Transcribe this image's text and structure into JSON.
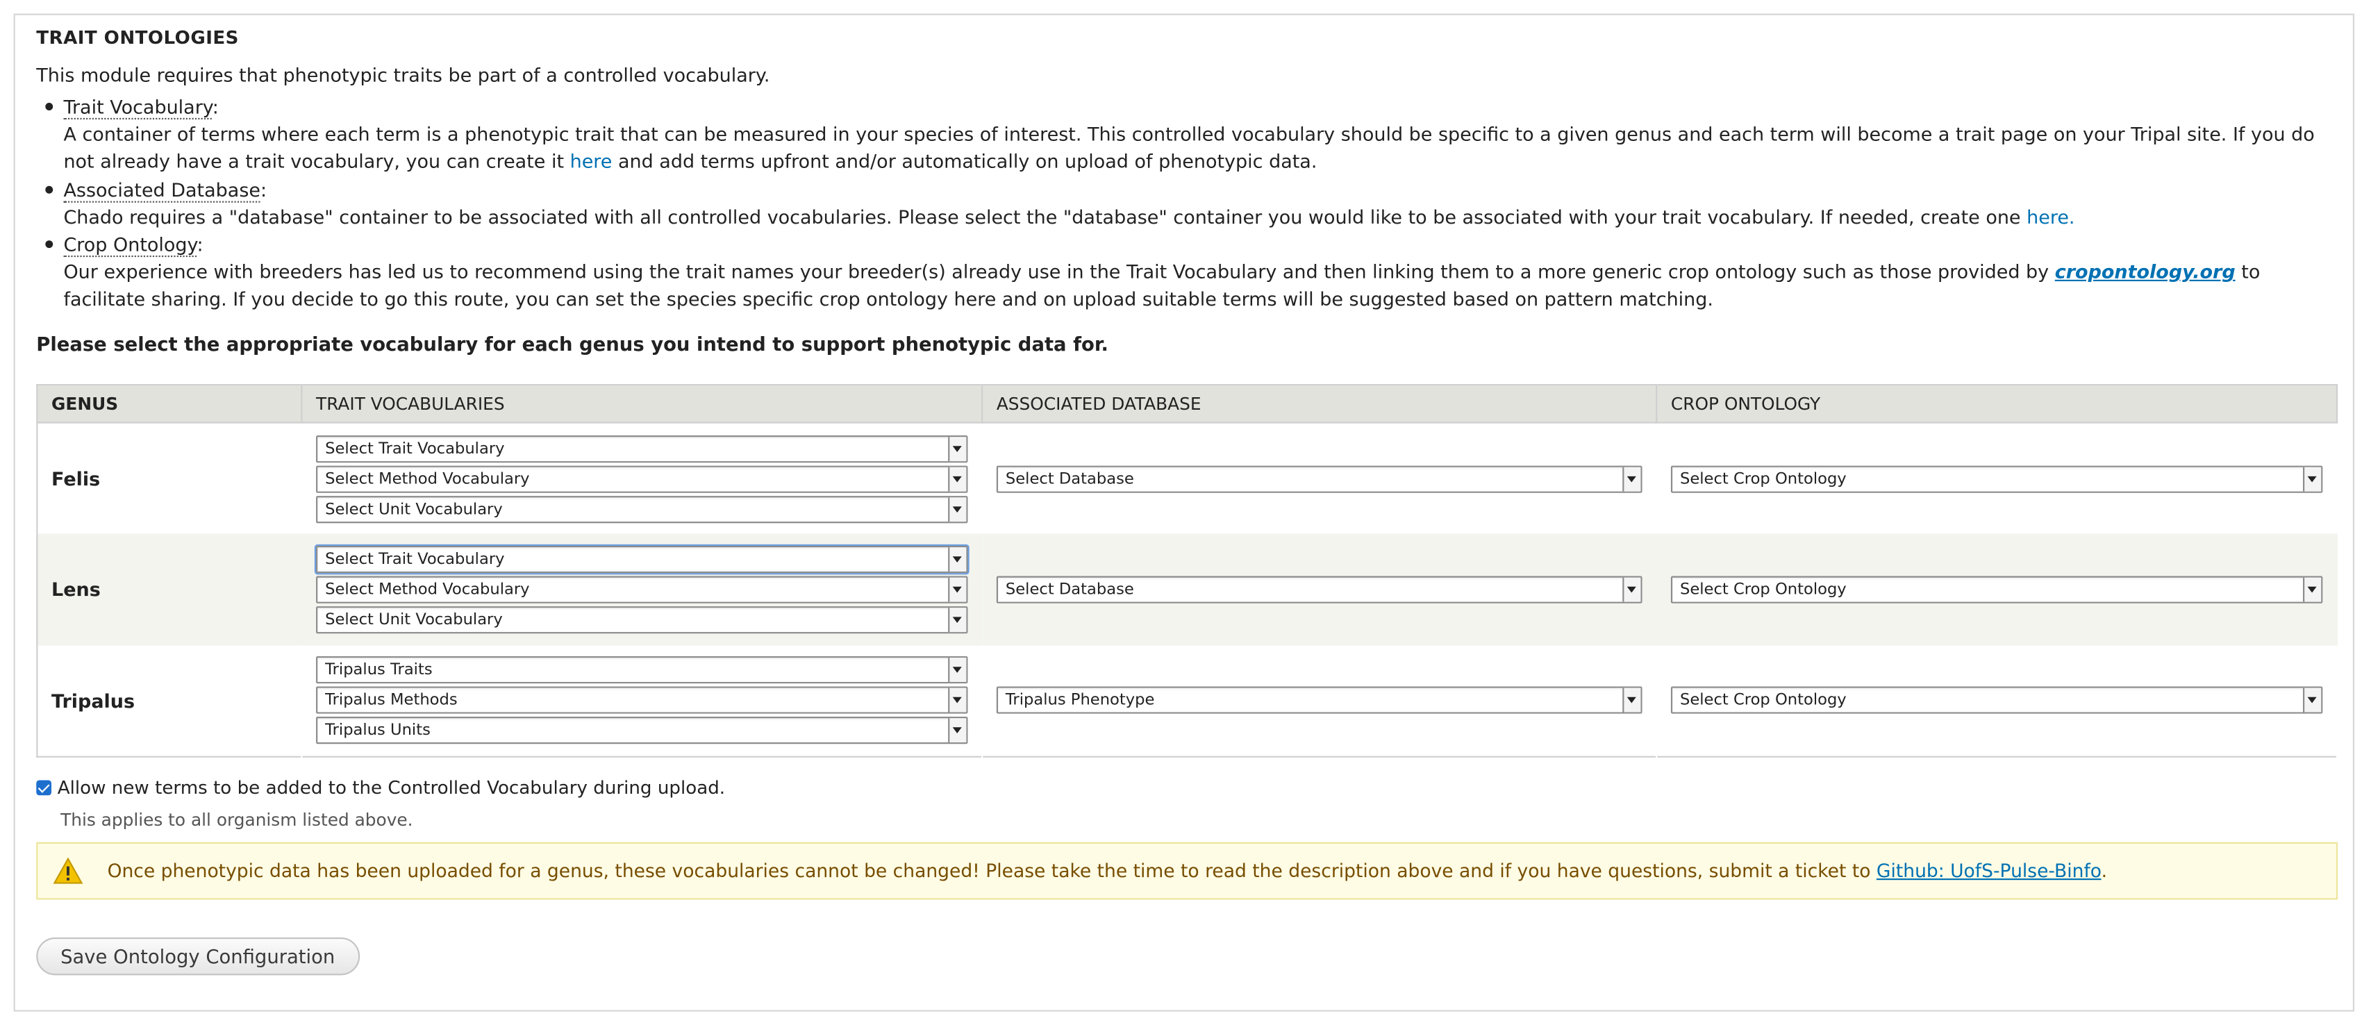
{
  "panel": {
    "title": "TRAIT ONTOLOGIES",
    "intro": "This module requires that phenotypic traits be part of a controlled vocabulary."
  },
  "definitions": [
    {
      "term": "Trait Vocabulary",
      "text_before": "A container of terms where each term is a phenotypic trait that can be measured in your species of interest. This controlled vocabulary should be specific to a given genus and each term will become a trait page on your Tripal site. If you do not already have a trait vocabulary, you can create it ",
      "link": "here",
      "text_after": " and add terms upfront and/or automatically on upload of phenotypic data."
    },
    {
      "term": "Associated Database",
      "text_before": "Chado requires a \"database\" container to be associated with all controlled vocabularies. Please select the \"database\" container you would like to be associated with your trait vocabulary. If needed, create one ",
      "link": "here.",
      "text_after": ""
    },
    {
      "term": "Crop Ontology",
      "text_before": "Our experience with breeders has led us to recommend using the trait names your breeder(s) already use in the Trait Vocabulary and then linking them to a more generic crop ontology such as those provided by ",
      "link": "cropontology.org",
      "text_after": " to facilitate sharing. If you decide to go this route, you can set the species specific crop ontology here and on upload suitable terms will be suggested based on pattern matching."
    }
  ],
  "prompt": "Please select the appropriate vocabulary for each genus you intend to support phenotypic data for.",
  "table": {
    "headers": [
      "GENUS",
      "TRAIT VOCABULARIES",
      "ASSOCIATED DATABASE",
      "CROP ONTOLOGY"
    ],
    "rows": [
      {
        "genus": "Felis",
        "trait": "Select Trait Vocabulary",
        "method": "Select Method Vocabulary",
        "unit": "Select Unit Vocabulary",
        "database": "Select Database",
        "crop": "Select Crop Ontology"
      },
      {
        "genus": "Lens",
        "trait": "Select Trait Vocabulary",
        "method": "Select Method Vocabulary",
        "unit": "Select Unit Vocabulary",
        "database": "Select Database",
        "crop": "Select Crop Ontology"
      },
      {
        "genus": "Tripalus",
        "trait": "Tripalus Traits",
        "method": "Tripalus Methods",
        "unit": "Tripalus Units",
        "database": "Tripalus Phenotype",
        "crop": "Select Crop Ontology"
      }
    ]
  },
  "allow_new_terms": {
    "checked": true,
    "label": "Allow new terms to be added to the Controlled Vocabulary during upload.",
    "description": "This applies to all organism listed above."
  },
  "warning": {
    "icon": "warning-triangle-icon",
    "text": "Once phenotypic data has been uploaded for a genus, these vocabularies cannot be changed! Please take the time to read the description above and if you have questions, submit a ticket to ",
    "link": "Github: UofS-Pulse-Binfo",
    "end": "."
  },
  "save_button": "Save Ontology Configuration",
  "colors": {
    "link": "#0071b3",
    "header_bg": "#e1e2dc",
    "warning_bg": "#fffce5",
    "warning_text": "#774e00",
    "warning_icon": "#f2c200",
    "checkbox": "#1d6fce"
  }
}
